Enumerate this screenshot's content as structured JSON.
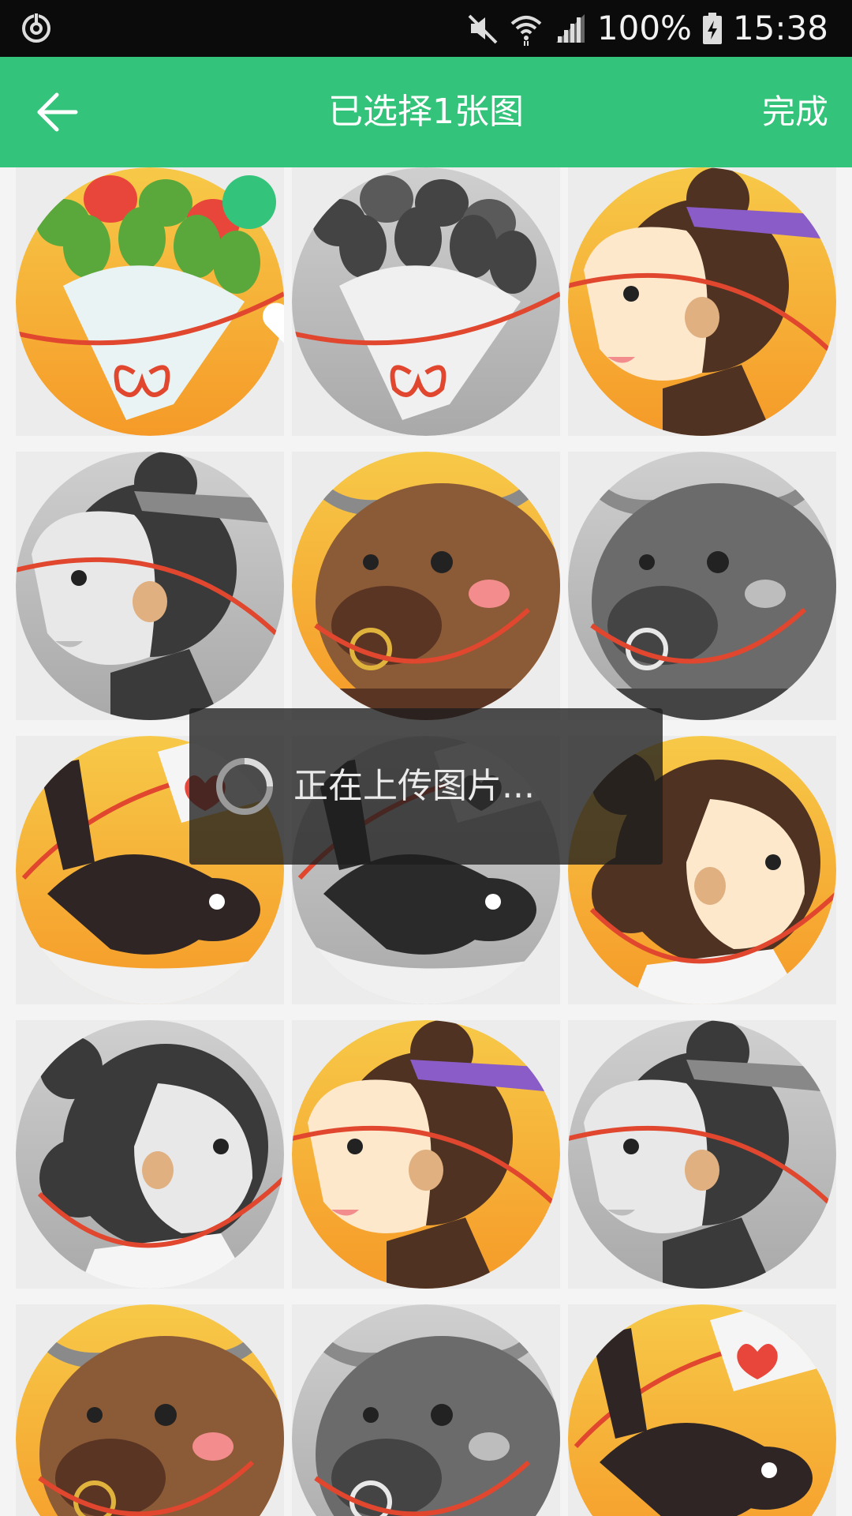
{
  "status_bar": {
    "battery": "100%",
    "time": "15:38",
    "icons": [
      "sync-icon",
      "mute-icon",
      "wifi-icon",
      "signal-icon",
      "battery-charging-icon"
    ]
  },
  "app_bar": {
    "title": "已选择1张图",
    "done_label": "完成",
    "back_icon": "back-arrow-icon",
    "color": "#34c37a"
  },
  "grid": {
    "items": [
      {
        "subject": "bouquet",
        "tone": "color",
        "selected": true
      },
      {
        "subject": "bouquet",
        "tone": "gray",
        "selected": false
      },
      {
        "subject": "girl",
        "tone": "color",
        "selected": false
      },
      {
        "subject": "girl",
        "tone": "gray",
        "selected": false
      },
      {
        "subject": "ox",
        "tone": "color",
        "selected": false
      },
      {
        "subject": "ox",
        "tone": "gray",
        "selected": false
      },
      {
        "subject": "magpie",
        "tone": "color",
        "selected": false
      },
      {
        "subject": "magpie",
        "tone": "gray",
        "selected": false
      },
      {
        "subject": "weaver-girl",
        "tone": "color",
        "selected": false
      },
      {
        "subject": "weaver-girl",
        "tone": "gray",
        "selected": false
      },
      {
        "subject": "girl",
        "tone": "color",
        "selected": false
      },
      {
        "subject": "girl",
        "tone": "gray",
        "selected": false
      },
      {
        "subject": "ox",
        "tone": "color",
        "selected": false
      },
      {
        "subject": "ox",
        "tone": "gray",
        "selected": false
      },
      {
        "subject": "magpie",
        "tone": "color",
        "selected": false
      }
    ]
  },
  "toast": {
    "text": "正在上传图片..."
  }
}
